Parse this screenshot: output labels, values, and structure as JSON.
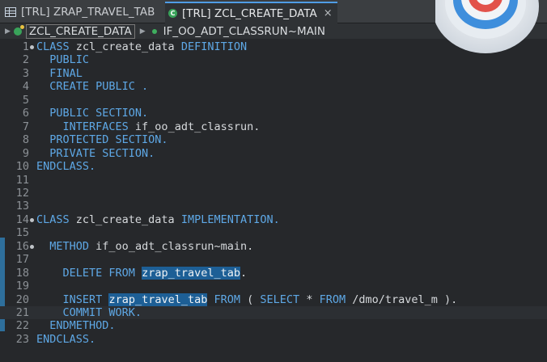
{
  "tabs": [
    {
      "label": "[TRL] ZRAP_TRAVEL_TAB",
      "icon": "table-icon",
      "active": false
    },
    {
      "label": "[TRL] ZCL_CREATE_DATA",
      "icon": "class-icon",
      "active": true,
      "close": "×"
    }
  ],
  "breadcrumb": [
    {
      "label": "ZCL_CREATE_DATA",
      "icon": "class-icon"
    },
    {
      "label": "IF_OO_ADT_CLASSRUN~MAIN",
      "icon": "method-dot-icon"
    }
  ],
  "colors": {
    "keyword": "#5ea8e6",
    "text": "#d6d9dc",
    "selection": "#1d5f96",
    "line_number": "#8c9196"
  },
  "decoration": {
    "icon": "target-icon"
  },
  "code_lines": [
    {
      "n": "1",
      "fold": true,
      "segs": [
        [
          "kw",
          "CLASS"
        ],
        [
          "t",
          " zcl_create_data "
        ],
        [
          "kw",
          "DEFINITION"
        ]
      ]
    },
    {
      "n": "2",
      "segs": [
        [
          "t",
          "  "
        ],
        [
          "kw",
          "PUBLIC"
        ]
      ]
    },
    {
      "n": "3",
      "segs": [
        [
          "t",
          "  "
        ],
        [
          "kw",
          "FINAL"
        ]
      ]
    },
    {
      "n": "4",
      "segs": [
        [
          "t",
          "  "
        ],
        [
          "kw",
          "CREATE PUBLIC ."
        ]
      ]
    },
    {
      "n": "5",
      "segs": []
    },
    {
      "n": "6",
      "segs": [
        [
          "t",
          "  "
        ],
        [
          "kw",
          "PUBLIC SECTION."
        ]
      ]
    },
    {
      "n": "7",
      "segs": [
        [
          "t",
          "    "
        ],
        [
          "kw",
          "INTERFACES"
        ],
        [
          "t",
          " if_oo_adt_classrun."
        ]
      ]
    },
    {
      "n": "8",
      "segs": [
        [
          "t",
          "  "
        ],
        [
          "kw",
          "PROTECTED SECTION."
        ]
      ]
    },
    {
      "n": "9",
      "segs": [
        [
          "t",
          "  "
        ],
        [
          "kw",
          "PRIVATE SECTION."
        ]
      ]
    },
    {
      "n": "10",
      "segs": [
        [
          "kw",
          "ENDCLASS."
        ]
      ]
    },
    {
      "n": "11",
      "segs": []
    },
    {
      "n": "12",
      "segs": []
    },
    {
      "n": "13",
      "segs": []
    },
    {
      "n": "14",
      "fold": true,
      "segs": [
        [
          "kw",
          "CLASS"
        ],
        [
          "t",
          " zcl_create_data "
        ],
        [
          "kw",
          "IMPLEMENTATION."
        ]
      ]
    },
    {
      "n": "15",
      "segs": []
    },
    {
      "n": "16",
      "fold": true,
      "segs": [
        [
          "t",
          "  "
        ],
        [
          "kw",
          "METHOD"
        ],
        [
          "t",
          " if_oo_adt_classrun~main."
        ]
      ]
    },
    {
      "n": "17",
      "segs": []
    },
    {
      "n": "18",
      "segs": [
        [
          "t",
          "    "
        ],
        [
          "kw",
          "DELETE FROM"
        ],
        [
          "t",
          " "
        ],
        [
          "sel",
          "zrap_travel_tab"
        ],
        [
          "t",
          "."
        ]
      ]
    },
    {
      "n": "19",
      "segs": []
    },
    {
      "n": "20",
      "segs": [
        [
          "t",
          "    "
        ],
        [
          "kw",
          "INSERT"
        ],
        [
          "t",
          " "
        ],
        [
          "sel",
          "zrap_travel_tab"
        ],
        [
          "t",
          " "
        ],
        [
          "kw",
          "FROM"
        ],
        [
          "t",
          " ( "
        ],
        [
          "kw",
          "SELECT"
        ],
        [
          "t",
          " * "
        ],
        [
          "kw",
          "FROM"
        ],
        [
          "t",
          " /dmo/travel_m )."
        ]
      ]
    },
    {
      "n": "21",
      "current": true,
      "segs": [
        [
          "t",
          "    "
        ],
        [
          "kw",
          "COMMIT WORK."
        ]
      ]
    },
    {
      "n": "22",
      "segs": [
        [
          "t",
          "  "
        ],
        [
          "kw",
          "ENDMETHOD."
        ]
      ]
    },
    {
      "n": "23",
      "segs": [
        [
          "kw",
          "ENDCLASS."
        ]
      ]
    }
  ]
}
